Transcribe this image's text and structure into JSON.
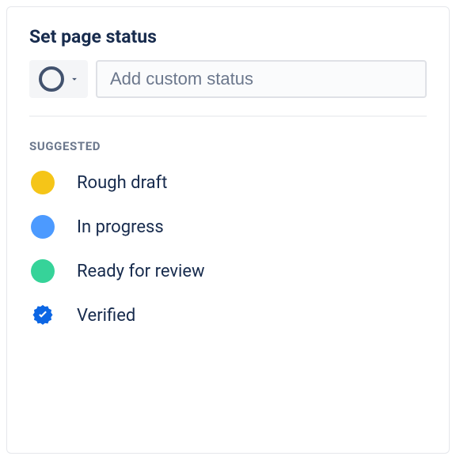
{
  "title": "Set page status",
  "input": {
    "placeholder": "Add custom status"
  },
  "suggested_label": "SUGGESTED",
  "statuses": [
    {
      "label": "Rough draft",
      "color": "#F5C518"
    },
    {
      "label": "In progress",
      "color": "#4C9AFF"
    },
    {
      "label": "Ready for review",
      "color": "#36D399"
    },
    {
      "label": "Verified",
      "badge": "verified",
      "badge_color": "#0C66E4"
    }
  ]
}
